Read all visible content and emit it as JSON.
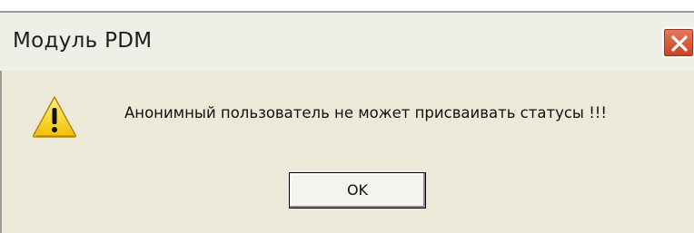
{
  "window": {
    "title": "Модуль PDM",
    "close_icon": "close-x-icon"
  },
  "dialog": {
    "icon": "warning-icon",
    "message": "Анонимный пользователь не может присваивать статусы !!!",
    "ok_label": "OK"
  },
  "colors": {
    "titlebar": "#efefe8",
    "body": "#ece9d8",
    "close_button": "#d4532f",
    "warning_yellow": "#f7d21c"
  }
}
